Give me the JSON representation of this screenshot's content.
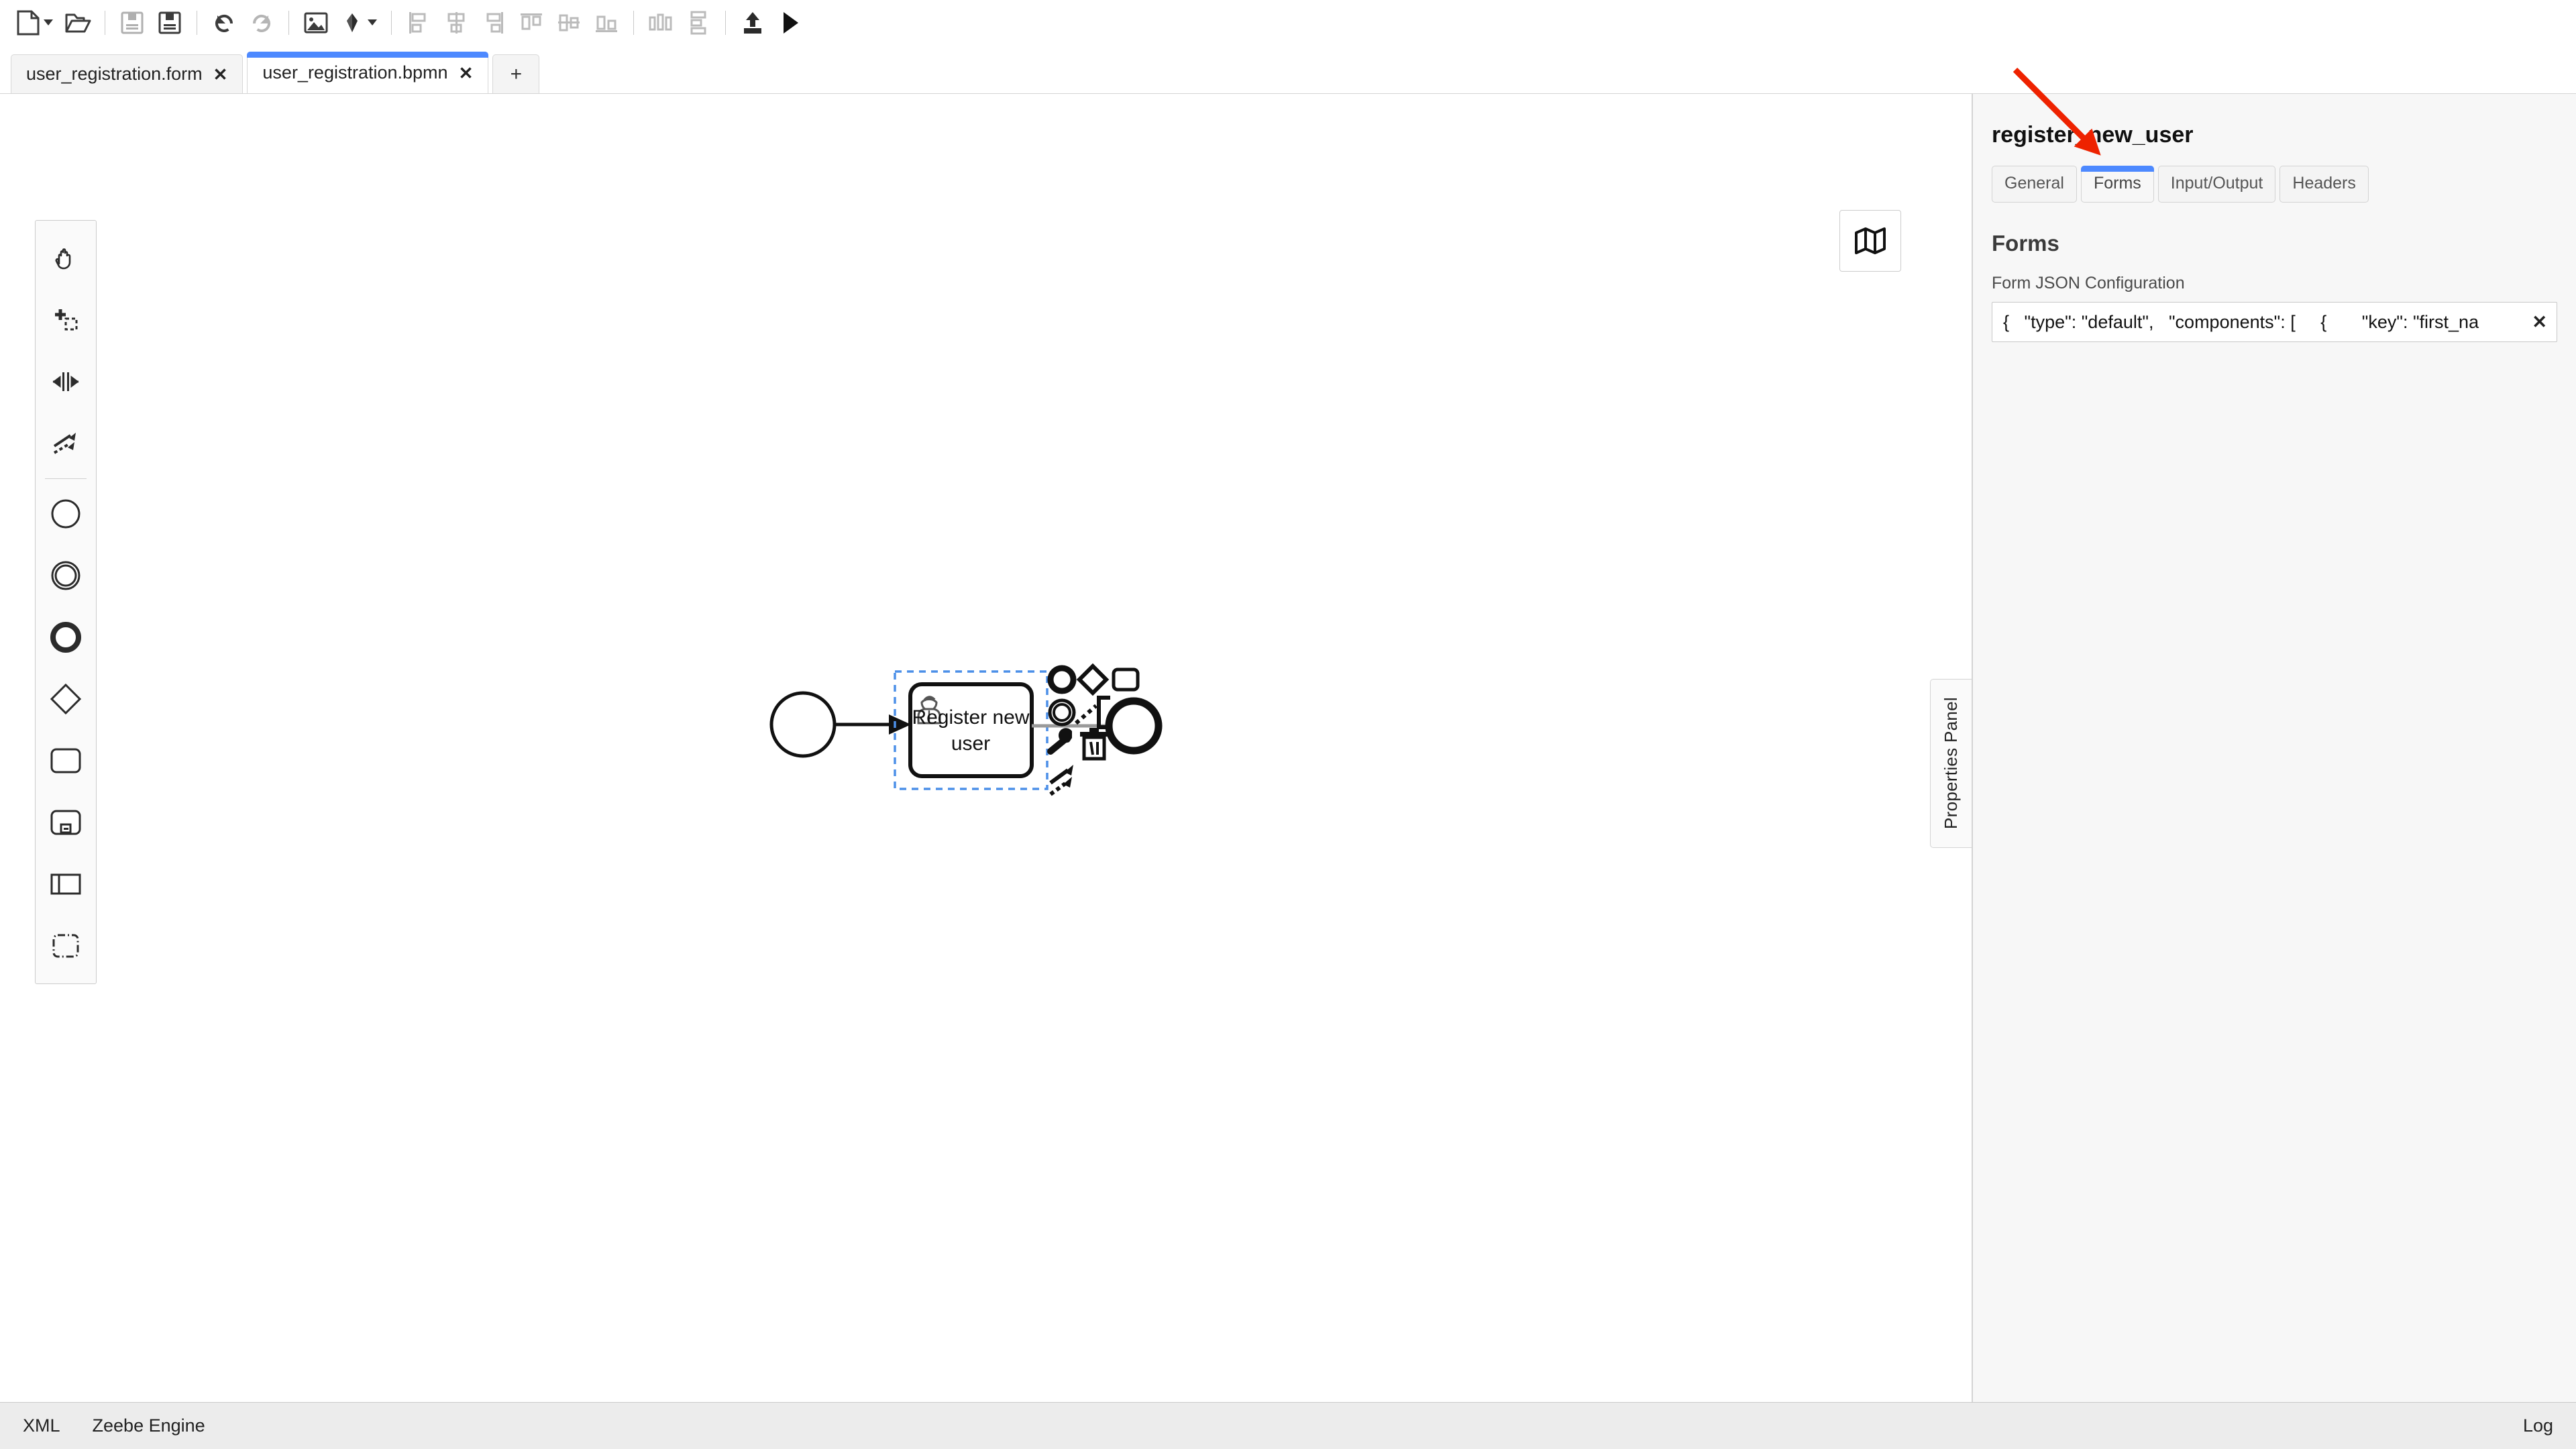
{
  "toolbar": {
    "items": [
      {
        "name": "new-file-button",
        "icon": "new-file-icon",
        "caret": true
      },
      {
        "name": "open-file-button",
        "icon": "open-folder-icon",
        "caret": false
      },
      {
        "sep": true
      },
      {
        "name": "save-button",
        "icon": "save-disk-icon",
        "caret": false,
        "disabled": true
      },
      {
        "name": "save-as-button",
        "icon": "save-as-disk-icon",
        "caret": false
      },
      {
        "sep": true
      },
      {
        "name": "undo-button",
        "icon": "undo-arrow-icon",
        "caret": false
      },
      {
        "name": "redo-button",
        "icon": "redo-arrow-icon",
        "caret": false,
        "disabled": true
      },
      {
        "sep": true
      },
      {
        "name": "export-image-button",
        "icon": "image-icon",
        "caret": false
      },
      {
        "name": "color-picker-button",
        "icon": "paint-marker-icon",
        "caret": true
      },
      {
        "sep": true
      },
      {
        "name": "align-left-button",
        "icon": "align-left-icon",
        "caret": false,
        "disabled": true
      },
      {
        "name": "align-center-button",
        "icon": "align-center-icon",
        "caret": false,
        "disabled": true
      },
      {
        "name": "align-right-button",
        "icon": "align-right-icon",
        "caret": false,
        "disabled": true
      },
      {
        "name": "align-top-button",
        "icon": "align-top-icon",
        "caret": false,
        "disabled": true
      },
      {
        "name": "align-middle-button",
        "icon": "align-middle-icon",
        "caret": false,
        "disabled": true
      },
      {
        "name": "align-bottom-button",
        "icon": "align-bottom-icon",
        "caret": false,
        "disabled": true
      },
      {
        "sep": true
      },
      {
        "name": "distribute-horizontal-button",
        "icon": "distribute-horizontal-icon",
        "caret": false,
        "disabled": true
      },
      {
        "name": "distribute-vertical-button",
        "icon": "distribute-vertical-icon",
        "caret": false,
        "disabled": true
      },
      {
        "sep": true
      },
      {
        "name": "deploy-button",
        "icon": "deploy-upload-icon",
        "caret": false
      },
      {
        "name": "run-button",
        "icon": "play-triangle-icon",
        "caret": false
      }
    ]
  },
  "tabs": {
    "items": [
      {
        "label": "user_registration.form",
        "close": "✕",
        "active": false
      },
      {
        "label": "user_registration.bpmn",
        "close": "✕",
        "active": true
      }
    ],
    "add_label": "+"
  },
  "palette": {
    "items": [
      {
        "name": "palette-hand-tool",
        "icon": "hand-icon"
      },
      {
        "name": "palette-lasso-tool",
        "icon": "lasso-select-icon"
      },
      {
        "name": "palette-space-tool",
        "icon": "space-tool-icon"
      },
      {
        "name": "palette-connect-tool",
        "icon": "connect-arrows-icon"
      },
      {
        "divider": true
      },
      {
        "name": "palette-start-event",
        "icon": "start-event-icon"
      },
      {
        "name": "palette-intermediate-event",
        "icon": "intermediate-event-icon"
      },
      {
        "name": "palette-end-event",
        "icon": "end-event-icon"
      },
      {
        "name": "palette-gateway",
        "icon": "gateway-diamond-icon"
      },
      {
        "name": "palette-task",
        "icon": "task-rectangle-icon"
      },
      {
        "name": "palette-subprocess",
        "icon": "subprocess-icon"
      },
      {
        "name": "palette-participant",
        "icon": "participant-pool-icon"
      },
      {
        "name": "palette-group",
        "icon": "group-dashed-icon"
      }
    ]
  },
  "canvas": {
    "minimap_icon": "map-icon",
    "diagram": {
      "start_event": {
        "name": "start-event"
      },
      "task": {
        "label_line1": "Register new",
        "label_line2": "user",
        "icon": "user-task-person-icon",
        "selected": true
      },
      "end_event": {
        "name": "end-event"
      },
      "context_pad": [
        {
          "name": "append-intermediate-event",
          "icon": "intermediate-event-icon"
        },
        {
          "name": "append-gateway",
          "icon": "gateway-diamond-icon"
        },
        {
          "name": "append-task",
          "icon": "task-rectangle-icon"
        },
        {
          "name": "append-end-event",
          "icon": "end-event-icon"
        },
        {
          "name": "append-text-annotation",
          "icon": "text-annotation-icon"
        },
        {
          "name": "change-type",
          "icon": "wrench-icon"
        },
        {
          "name": "delete-element",
          "icon": "trash-icon"
        },
        {
          "name": "connect",
          "icon": "connect-arrows-icon"
        }
      ]
    },
    "properties_panel_toggle": "Properties Panel"
  },
  "properties": {
    "title": "register_new_user",
    "tabs": [
      {
        "label": "General",
        "active": false
      },
      {
        "label": "Forms",
        "active": true
      },
      {
        "label": "Input/Output",
        "active": false
      },
      {
        "label": "Headers",
        "active": false
      }
    ],
    "section_heading": "Forms",
    "form_json": {
      "label": "Form JSON Configuration",
      "value": "{   \"type\": \"default\",   \"components\": [     {       \"key\": \"first_na",
      "placeholder": "",
      "clear_label": "✕"
    }
  },
  "annotation": {
    "color": "#ee2200",
    "target": "forms-tab"
  },
  "statusbar": {
    "xml_label": "XML",
    "engine_label": "Zeebe Engine",
    "log_label": "Log"
  },
  "colors": {
    "accent_blue": "#4d89ff",
    "selection_blue": "#4d90e8",
    "panel_bg": "#f7f7f7",
    "statusbar_bg": "#ececec",
    "annotation_red": "#ee2200"
  }
}
